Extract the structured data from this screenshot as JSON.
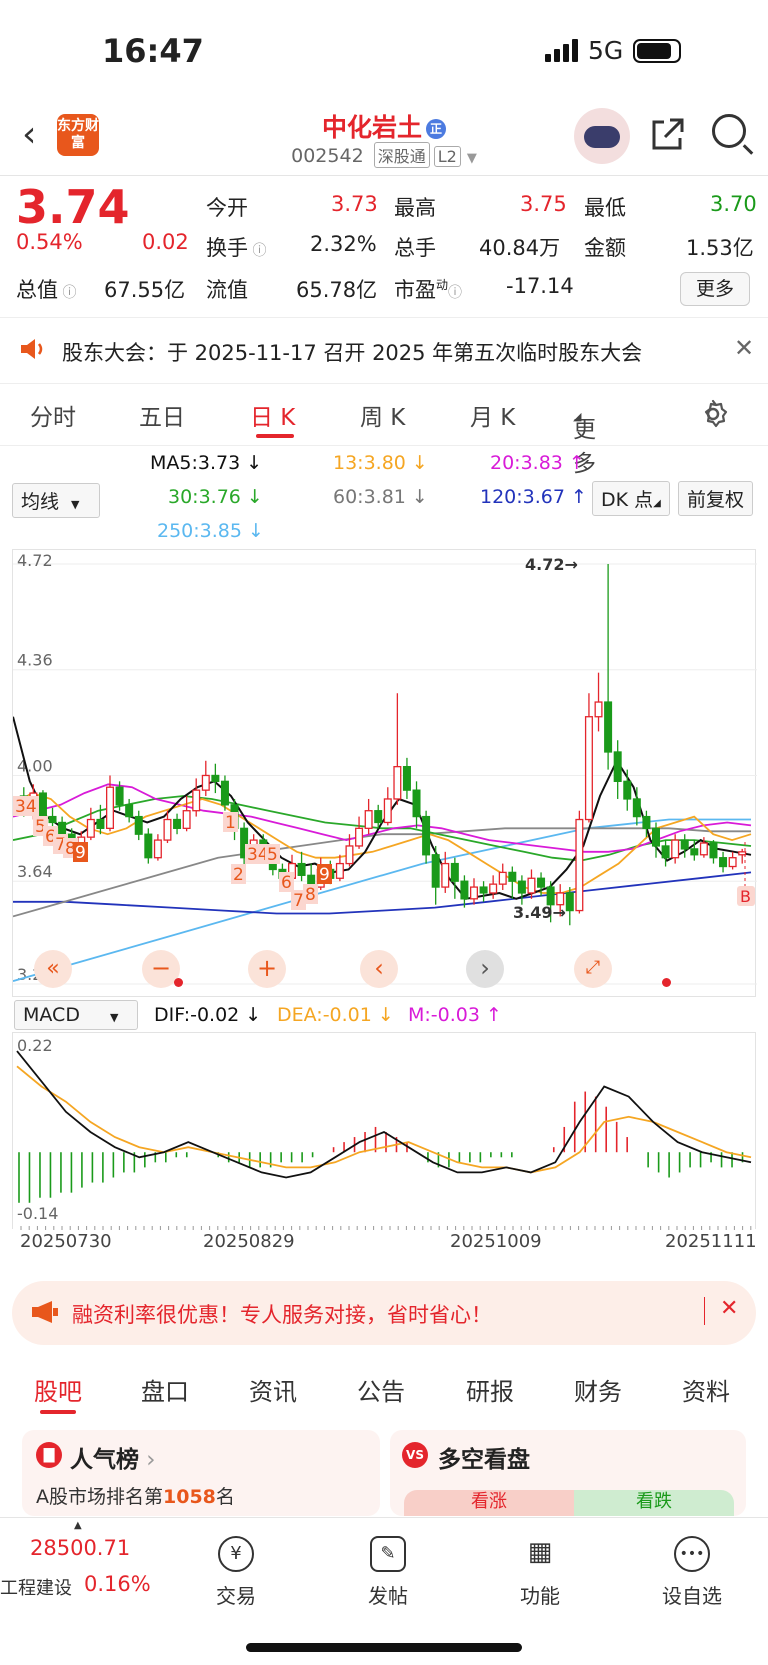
{
  "status_bar": {
    "time": "16:47",
    "network": "5G"
  },
  "header": {
    "back_icon": "chevron-left-icon",
    "logo_text": "东方财富",
    "stock_name": "中化岩土",
    "badge": "正",
    "stock_code": "002542",
    "tag_connect": "深股通",
    "tag_level": "L2"
  },
  "quote": {
    "price": "3.74",
    "change_pct": "0.54%",
    "change_amt": "0.02",
    "open_label": "今开",
    "open": "3.73",
    "high_label": "最高",
    "high": "3.75",
    "low_label": "最低",
    "low": "3.70",
    "turnover_label": "换手",
    "turnover": "2.32%",
    "volume_label": "总手",
    "volume": "40.84万",
    "amount_label": "金额",
    "amount": "1.53亿",
    "mktcap_label": "总值",
    "mktcap": "67.55亿",
    "float_label": "流值",
    "float_cap": "65.78亿",
    "pe_label": "市盈",
    "pe_sup": "动",
    "pe": "-17.14",
    "more_button": "更多"
  },
  "notice": {
    "text": "股东大会：于 2025-11-17 召开 2025 年第五次临时股东大会"
  },
  "chart_tabs": [
    {
      "label": "分时"
    },
    {
      "label": "五日"
    },
    {
      "label": "日 K"
    },
    {
      "label": "周 K"
    },
    {
      "label": "月 K"
    },
    {
      "label": "更多"
    }
  ],
  "ma_controls": {
    "selector": "均线",
    "ma5": "MA5:3.73 ↓",
    "ma13": "13:3.80 ↓",
    "ma20": "20:3.83 ↑",
    "ma30": "30:3.76 ↓",
    "ma60": "60:3.81 ↓",
    "ma120": "120:3.67 ↑",
    "ma250": "250:3.85 ↓",
    "dk_button": "DK 点",
    "adjust_button": "前复权"
  },
  "colors": {
    "up": "#e4252c",
    "down": "#1a9a1a",
    "ma5": "#111111",
    "ma13": "#f5a623",
    "ma20": "#d81bd8",
    "ma30": "#2aa82a",
    "ma60": "#888888",
    "ma120": "#2233bb",
    "ma250": "#5bb8f0"
  },
  "chart_data": {
    "type": "candlestick",
    "y_ticks": [
      "4.72",
      "4.36",
      "4.00",
      "3.64",
      "3.29"
    ],
    "ylim": [
      3.29,
      4.72
    ],
    "high_marker": "4.72→",
    "low_marker": "3.49→",
    "b_marker": "B",
    "candles": [
      [
        3.93,
        3.88,
        3.96,
        3.86
      ],
      [
        3.88,
        3.94,
        3.97,
        3.85
      ],
      [
        3.94,
        3.86,
        3.95,
        3.83
      ],
      [
        3.86,
        3.84,
        3.89,
        3.81
      ],
      [
        3.84,
        3.8,
        3.86,
        3.78
      ],
      [
        3.8,
        3.77,
        3.82,
        3.74
      ],
      [
        3.77,
        3.79,
        3.81,
        3.75
      ],
      [
        3.79,
        3.85,
        3.89,
        3.78
      ],
      [
        3.85,
        3.82,
        3.9,
        3.8
      ],
      [
        3.82,
        3.96,
        4.0,
        3.81
      ],
      [
        3.96,
        3.9,
        3.98,
        3.88
      ],
      [
        3.9,
        3.86,
        3.92,
        3.84
      ],
      [
        3.86,
        3.8,
        3.88,
        3.78
      ],
      [
        3.8,
        3.72,
        3.82,
        3.7
      ],
      [
        3.72,
        3.78,
        3.8,
        3.71
      ],
      [
        3.78,
        3.85,
        3.88,
        3.77
      ],
      [
        3.85,
        3.82,
        3.87,
        3.8
      ],
      [
        3.82,
        3.88,
        3.93,
        3.81
      ],
      [
        3.88,
        3.95,
        3.99,
        3.86
      ],
      [
        3.95,
        4.0,
        4.05,
        3.93
      ],
      [
        4.0,
        3.98,
        4.04,
        3.94
      ],
      [
        3.98,
        3.9,
        4.0,
        3.88
      ],
      [
        3.9,
        3.82,
        3.92,
        3.78
      ],
      [
        3.82,
        3.72,
        3.84,
        3.68
      ],
      [
        3.72,
        3.78,
        3.8,
        3.7
      ],
      [
        3.78,
        3.74,
        3.8,
        3.72
      ],
      [
        3.74,
        3.68,
        3.76,
        3.66
      ],
      [
        3.68,
        3.65,
        3.7,
        3.62
      ],
      [
        3.65,
        3.7,
        3.73,
        3.63
      ],
      [
        3.7,
        3.66,
        3.74,
        3.64
      ],
      [
        3.66,
        3.62,
        3.7,
        3.59
      ],
      [
        3.62,
        3.68,
        3.72,
        3.61
      ],
      [
        3.68,
        3.65,
        3.71,
        3.63
      ],
      [
        3.65,
        3.7,
        3.73,
        3.64
      ],
      [
        3.7,
        3.76,
        3.8,
        3.69
      ],
      [
        3.76,
        3.82,
        3.86,
        3.75
      ],
      [
        3.82,
        3.88,
        3.92,
        3.8
      ],
      [
        3.88,
        3.84,
        3.9,
        3.82
      ],
      [
        3.84,
        3.92,
        3.96,
        3.83
      ],
      [
        3.92,
        4.03,
        4.28,
        3.9
      ],
      [
        4.03,
        3.95,
        4.06,
        3.92
      ],
      [
        3.95,
        3.86,
        3.98,
        3.82
      ],
      [
        3.86,
        3.73,
        3.88,
        3.7
      ],
      [
        3.73,
        3.62,
        3.76,
        3.56
      ],
      [
        3.62,
        3.7,
        3.74,
        3.6
      ],
      [
        3.7,
        3.64,
        3.72,
        3.58
      ],
      [
        3.64,
        3.58,
        3.66,
        3.55
      ],
      [
        3.58,
        3.62,
        3.65,
        3.56
      ],
      [
        3.62,
        3.6,
        3.64,
        3.57
      ],
      [
        3.6,
        3.63,
        3.66,
        3.58
      ],
      [
        3.63,
        3.67,
        3.7,
        3.61
      ],
      [
        3.67,
        3.64,
        3.69,
        3.58
      ],
      [
        3.64,
        3.6,
        3.66,
        3.56
      ],
      [
        3.6,
        3.65,
        3.68,
        3.58
      ],
      [
        3.65,
        3.62,
        3.67,
        3.59
      ],
      [
        3.62,
        3.56,
        3.64,
        3.5
      ],
      [
        3.56,
        3.6,
        3.63,
        3.52
      ],
      [
        3.6,
        3.54,
        3.62,
        3.49
      ],
      [
        3.54,
        3.85,
        3.88,
        3.53
      ],
      [
        3.85,
        4.2,
        4.28,
        3.84
      ],
      [
        4.2,
        4.25,
        4.35,
        4.15
      ],
      [
        4.25,
        4.08,
        4.72,
        4.02
      ],
      [
        4.08,
        3.98,
        4.12,
        3.92
      ],
      [
        3.98,
        3.92,
        4.02,
        3.88
      ],
      [
        3.92,
        3.86,
        3.96,
        3.83
      ],
      [
        3.86,
        3.82,
        3.88,
        3.79
      ],
      [
        3.82,
        3.76,
        3.84,
        3.72
      ],
      [
        3.76,
        3.72,
        3.78,
        3.69
      ],
      [
        3.72,
        3.78,
        3.8,
        3.7
      ],
      [
        3.78,
        3.75,
        3.8,
        3.72
      ],
      [
        3.75,
        3.73,
        3.78,
        3.71
      ],
      [
        3.73,
        3.77,
        3.79,
        3.72
      ],
      [
        3.77,
        3.72,
        3.78,
        3.7
      ],
      [
        3.72,
        3.69,
        3.74,
        3.67
      ],
      [
        3.69,
        3.72,
        3.74,
        3.68
      ],
      [
        3.73,
        3.74,
        3.75,
        3.7
      ]
    ],
    "ma_series": {
      "ma5": [
        4.2,
        3.98,
        3.86,
        3.82,
        3.8,
        3.84,
        3.88,
        3.86,
        3.84,
        3.86,
        3.92,
        3.96,
        3.98,
        3.93,
        3.84,
        3.78,
        3.72,
        3.69,
        3.7,
        3.67,
        3.68,
        3.74,
        3.84,
        3.92,
        3.9,
        3.76,
        3.65,
        3.58,
        3.59,
        3.6,
        3.58,
        3.6,
        3.62,
        3.68,
        3.76,
        3.93,
        4.05,
        3.96,
        3.78,
        3.71,
        3.74,
        3.78,
        3.75,
        3.74,
        3.73
      ],
      "ma13": [
        3.9,
        3.94,
        3.92,
        3.86,
        3.82,
        3.8,
        3.82,
        3.86,
        3.88,
        3.9,
        3.92,
        3.9,
        3.86,
        3.82,
        3.78,
        3.74,
        3.72,
        3.72,
        3.73,
        3.74,
        3.76,
        3.78,
        3.8,
        3.78,
        3.74,
        3.7,
        3.66,
        3.62,
        3.6,
        3.6,
        3.62,
        3.66,
        3.7,
        3.76,
        3.82,
        3.84,
        3.86,
        3.8,
        3.78,
        3.8
      ],
      "ma20": [
        3.86,
        3.88,
        3.9,
        3.94,
        3.97,
        3.96,
        3.92,
        3.9,
        3.88,
        3.87,
        3.86,
        3.84,
        3.82,
        3.8,
        3.78,
        3.8,
        3.82,
        3.83,
        3.82,
        3.8,
        3.78,
        3.77,
        3.76,
        3.75,
        3.74,
        3.74,
        3.75,
        3.78,
        3.81,
        3.83,
        3.84,
        3.83
      ],
      "ma30": [
        3.78,
        3.8,
        3.84,
        3.88,
        3.9,
        3.92,
        3.93,
        3.92,
        3.9,
        3.88,
        3.86,
        3.84,
        3.83,
        3.82,
        3.82,
        3.8,
        3.78,
        3.76,
        3.74,
        3.72,
        3.71,
        3.73,
        3.76,
        3.78,
        3.78,
        3.77,
        3.76
      ],
      "ma60": [
        3.52,
        3.56,
        3.6,
        3.64,
        3.68,
        3.72,
        3.74,
        3.76,
        3.78,
        3.8,
        3.8,
        3.81,
        3.82,
        3.82,
        3.82,
        3.82,
        3.82,
        3.81,
        3.81
      ],
      "ma120": [
        3.57,
        3.57,
        3.56,
        3.55,
        3.54,
        3.53,
        3.53,
        3.54,
        3.55,
        3.57,
        3.59,
        3.61,
        3.63,
        3.65,
        3.67
      ],
      "ma250": [
        3.3,
        3.38,
        3.46,
        3.54,
        3.62,
        3.7,
        3.76,
        3.82,
        3.85,
        3.85
      ]
    },
    "buy_points": [
      "34",
      "5",
      "6",
      "7",
      "8",
      "9",
      "1",
      "2",
      "34",
      "5",
      "6",
      "7",
      "8",
      "9"
    ],
    "macd": {
      "label": "MACD",
      "dif": "DIF:-0.02 ↓",
      "dea": "DEA:-0.01 ↓",
      "m": "M:-0.03 ↑",
      "ylim": [
        -0.14,
        0.22
      ],
      "y_top": "0.22",
      "y_bottom": "-0.14",
      "dif_series": [
        0.2,
        0.14,
        0.08,
        0.04,
        0.01,
        -0.01,
        0.0,
        0.02,
        0.0,
        -0.02,
        -0.04,
        -0.05,
        -0.04,
        -0.01,
        0.02,
        0.04,
        0.01,
        -0.02,
        -0.04,
        -0.04,
        -0.03,
        -0.04,
        -0.02,
        0.06,
        0.13,
        0.11,
        0.06,
        0.02,
        0.0,
        -0.01,
        -0.02
      ],
      "dea_series": [
        0.17,
        0.13,
        0.1,
        0.06,
        0.03,
        0.01,
        0.0,
        0.01,
        0.0,
        -0.01,
        -0.02,
        -0.03,
        -0.03,
        -0.02,
        0.0,
        0.01,
        0.02,
        0.0,
        -0.02,
        -0.03,
        -0.03,
        -0.04,
        -0.03,
        0.0,
        0.06,
        0.07,
        0.06,
        0.04,
        0.02,
        0.0,
        -0.01
      ],
      "hist": [
        -0.1,
        -0.1,
        -0.09,
        -0.09,
        -0.08,
        -0.08,
        -0.07,
        -0.06,
        -0.06,
        -0.05,
        -0.04,
        -0.04,
        -0.03,
        -0.02,
        -0.02,
        -0.01,
        -0.01,
        0.0,
        0.0,
        -0.01,
        -0.02,
        -0.02,
        -0.03,
        -0.03,
        -0.03,
        -0.02,
        -0.02,
        -0.02,
        -0.01,
        0.0,
        0.01,
        0.02,
        0.03,
        0.04,
        0.05,
        0.04,
        0.03,
        0.02,
        0.0,
        -0.02,
        -0.03,
        -0.03,
        -0.02,
        -0.02,
        -0.02,
        -0.01,
        -0.01,
        -0.01,
        0.0,
        0.0,
        0.0,
        0.01,
        0.05,
        0.1,
        0.12,
        0.11,
        0.09,
        0.06,
        0.03,
        0.0,
        -0.03,
        -0.04,
        -0.05,
        -0.04,
        -0.03,
        -0.03,
        -0.02,
        -0.03,
        -0.03,
        -0.02
      ]
    },
    "x_labels": [
      "20250730",
      "20250829",
      "20251009",
      "20251111"
    ]
  },
  "ad_bar": {
    "text": "融资利率很优惠！专人服务对接，省时省心！"
  },
  "bottom_tabs": [
    {
      "label": "股吧"
    },
    {
      "label": "盘口"
    },
    {
      "label": "资讯"
    },
    {
      "label": "公告"
    },
    {
      "label": "研报"
    },
    {
      "label": "财务"
    },
    {
      "label": "资料"
    }
  ],
  "cards": {
    "popularity_title": "人气榜",
    "popularity_text": "A股市场排名第",
    "popularity_rank": "1058",
    "popularity_suffix": "名",
    "bullbear_title": "多空看盘",
    "bull_label": "看涨",
    "bear_label": "看跌"
  },
  "bottom_nav": {
    "index_value": "28500.71",
    "index_name": "工程建设",
    "index_change": "0.16%",
    "trade": "交易",
    "post": "发帖",
    "function": "功能",
    "watchlist": "设自选"
  }
}
